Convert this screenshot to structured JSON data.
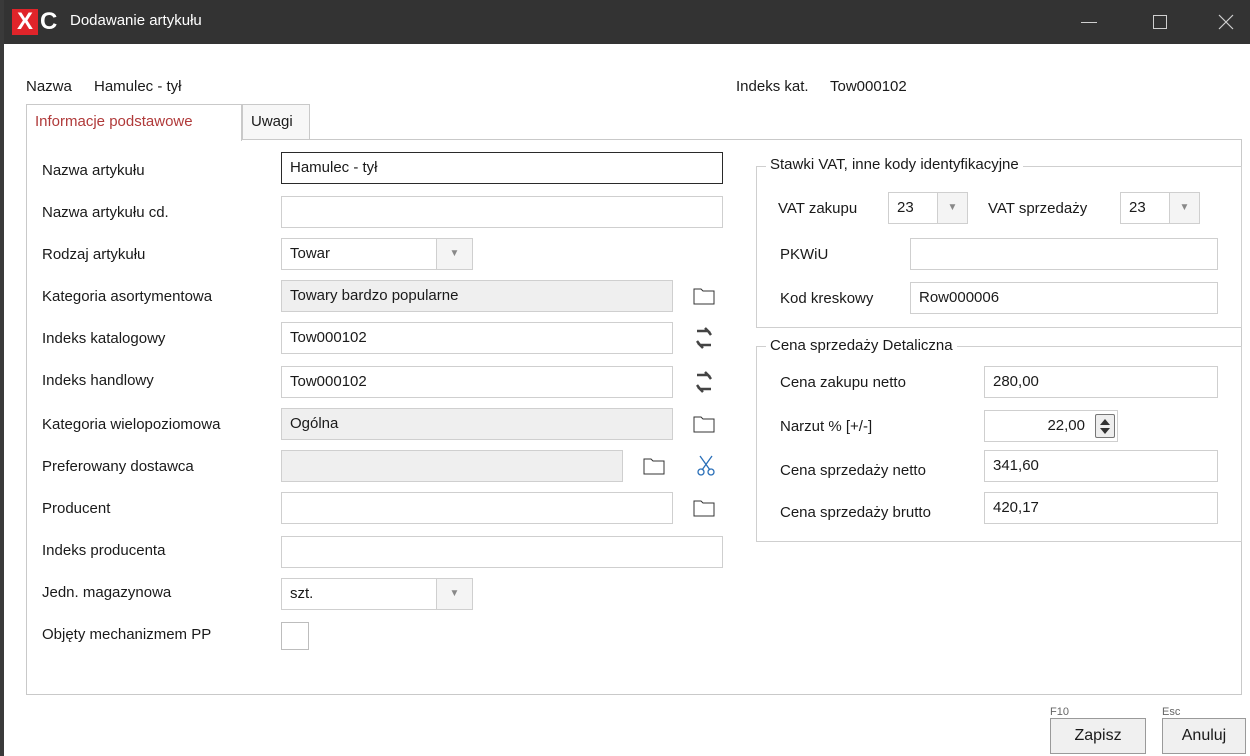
{
  "window": {
    "title": "Dodawanie artykułu",
    "logo_x": "X",
    "logo_c": "C"
  },
  "header": {
    "name_label": "Nazwa",
    "name_value": "Hamulec - tył",
    "index_label": "Indeks kat.",
    "index_value": "Tow000102"
  },
  "tabs": [
    {
      "label": "Informacje podstawowe",
      "active": true
    },
    {
      "label": "Uwagi",
      "active": false
    }
  ],
  "form": {
    "nazwa_artykulu": {
      "label": "Nazwa artykułu",
      "value": "Hamulec - tył"
    },
    "nazwa_artykulu_cd": {
      "label": "Nazwa artykułu cd.",
      "value": ""
    },
    "rodzaj_artykulu": {
      "label": "Rodzaj artykułu",
      "value": "Towar"
    },
    "kategoria_asortymentowa": {
      "label": "Kategoria asortymentowa",
      "value": "Towary bardzo popularne"
    },
    "indeks_katalogowy": {
      "label": "Indeks katalogowy",
      "value": "Tow000102"
    },
    "indeks_handlowy": {
      "label": "Indeks handlowy",
      "value": "Tow000102"
    },
    "kategoria_wielopoziomowa": {
      "label": "Kategoria wielopoziomowa",
      "value": "Ogólna"
    },
    "preferowany_dostawca": {
      "label": "Preferowany dostawca",
      "value": ""
    },
    "producent": {
      "label": "Producent",
      "value": ""
    },
    "indeks_producenta": {
      "label": "Indeks producenta",
      "value": ""
    },
    "jedn_magazynowa": {
      "label": "Jedn. magazynowa",
      "value": "szt."
    },
    "objety_pp": {
      "label": "Objęty mechanizmem PP",
      "checked": false
    }
  },
  "vat_group": {
    "title": "Stawki VAT, inne kody identyfikacyjne",
    "vat_zakupu_label": "VAT zakupu",
    "vat_zakupu_value": "23",
    "vat_sprzedazy_label": "VAT sprzedaży",
    "vat_sprzedazy_value": "23",
    "pkwiu_label": "PKWiU",
    "pkwiu_value": "",
    "kod_kreskowy_label": "Kod kreskowy",
    "kod_kreskowy_value": "Row000006"
  },
  "price_group": {
    "title": "Cena sprzedaży  Detaliczna",
    "cena_zakupu_label": "Cena zakupu netto",
    "cena_zakupu_value": "280,00",
    "narzut_label": "Narzut % [+/-]",
    "narzut_value": "22,00",
    "cena_netto_label": "Cena sprzedaży netto",
    "cena_netto_value": "341,60",
    "cena_brutto_label": "Cena sprzedaży brutto",
    "cena_brutto_value": "420,17"
  },
  "footer": {
    "save_shortcut": "F10",
    "save_label": "Zapisz",
    "cancel_shortcut": "Esc",
    "cancel_label": "Anuluj"
  },
  "icons": {
    "folder": "folder-icon",
    "refresh": "refresh-icon",
    "scissors": "scissors-icon",
    "dropdown": "chevron-down-icon"
  },
  "colors": {
    "titlebar": "#333333",
    "logo_red": "#e0242a",
    "active_tab_text": "#b03a3a"
  }
}
